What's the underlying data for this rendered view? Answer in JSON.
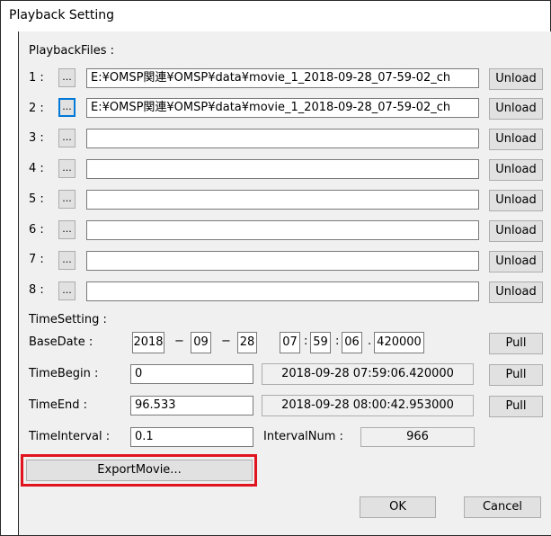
{
  "window": {
    "title": "Playback Setting"
  },
  "playback": {
    "section_label": "PlaybackFiles :",
    "rows": [
      {
        "num": "1 :",
        "browse": "...",
        "path": "E:¥OMSP関連¥OMSP¥data¥movie_1_2018-09-28_07-59-02_ch",
        "unload": "Unload"
      },
      {
        "num": "2 :",
        "browse": "...",
        "path": "E:¥OMSP関連¥OMSP¥data¥movie_1_2018-09-28_07-59-02_ch",
        "unload": "Unload"
      },
      {
        "num": "3 :",
        "browse": "...",
        "path": "",
        "unload": "Unload"
      },
      {
        "num": "4 :",
        "browse": "...",
        "path": "",
        "unload": "Unload"
      },
      {
        "num": "5 :",
        "browse": "...",
        "path": "",
        "unload": "Unload"
      },
      {
        "num": "6 :",
        "browse": "...",
        "path": "",
        "unload": "Unload"
      },
      {
        "num": "7 :",
        "browse": "...",
        "path": "",
        "unload": "Unload"
      },
      {
        "num": "8 :",
        "browse": "...",
        "path": "",
        "unload": "Unload"
      }
    ]
  },
  "time": {
    "section_label": "TimeSetting :",
    "base_date_label": "BaseDate :",
    "year": "2018",
    "month": "09",
    "day": "28",
    "hour": "07",
    "minute": "59",
    "second": "06",
    "fraction": "420000",
    "sep_dash": "−",
    "sep_colon": ":",
    "sep_dot": ".",
    "pull_label": "Pull",
    "begin_label": "TimeBegin :",
    "begin_value": "0",
    "begin_display": "2018-09-28 07:59:06.420000",
    "end_label": "TimeEnd :",
    "end_value": "96.533",
    "end_display": "2018-09-28 08:00:42.953000",
    "interval_label": "TimeInterval :",
    "interval_value": "0.1",
    "interval_num_label": "IntervalNum :",
    "interval_num_value": "966"
  },
  "actions": {
    "export_label": "ExportMovie...",
    "ok_label": "OK",
    "cancel_label": "Cancel"
  },
  "colors": {
    "highlight": "#e0141e",
    "focus": "#0078d7"
  }
}
